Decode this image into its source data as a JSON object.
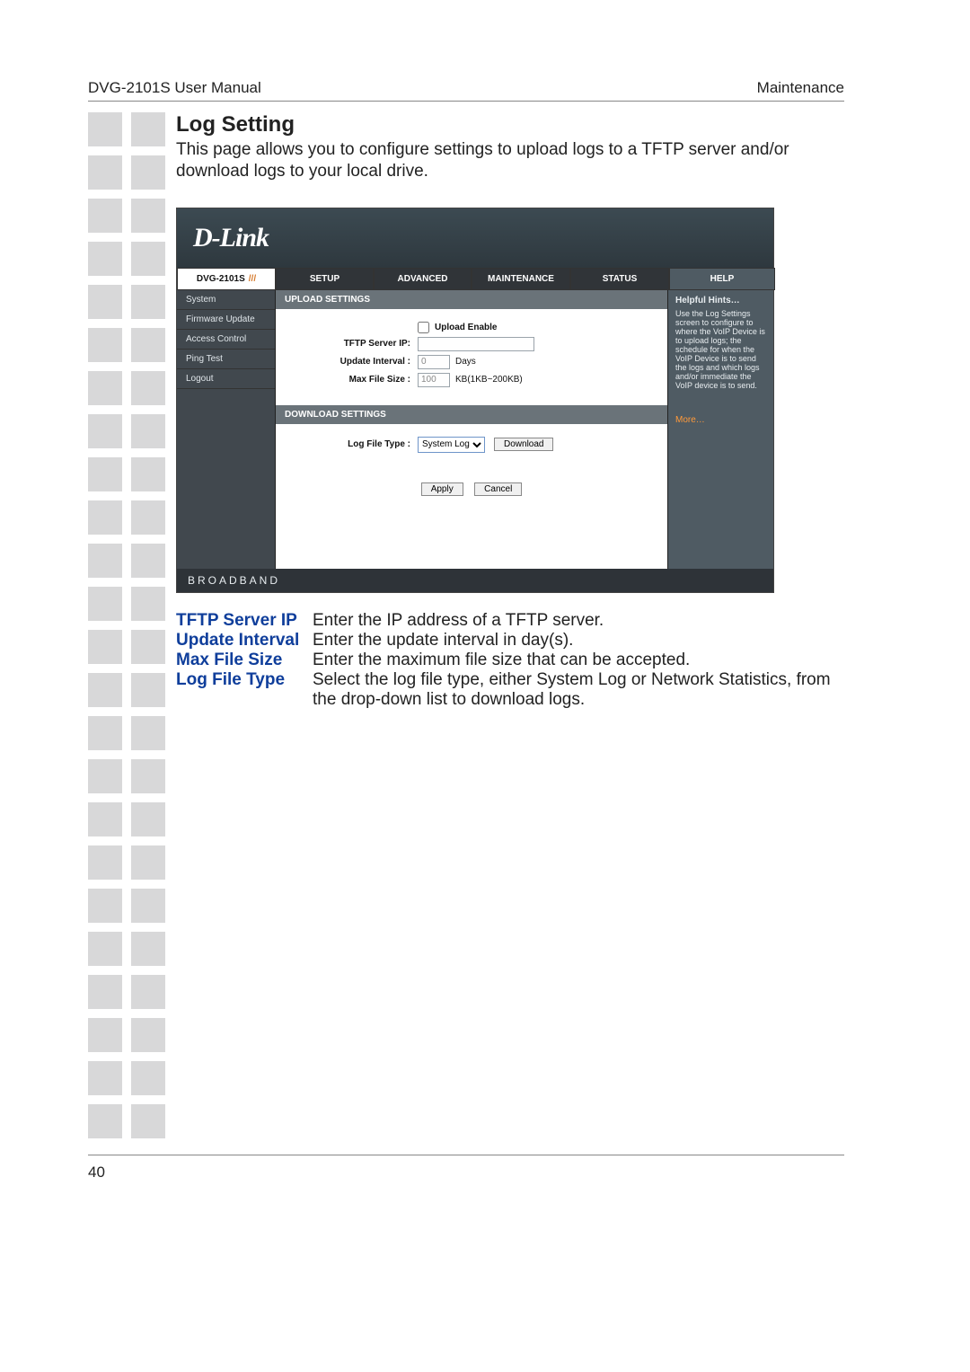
{
  "page": {
    "header_left": "DVG-2101S User Manual",
    "header_right": "Maintenance",
    "number": "40"
  },
  "section": {
    "title": "Log Setting",
    "intro": "This page allows you to configure settings to upload logs to a TFTP server and/or download logs to your local drive."
  },
  "router": {
    "logo": "D-Link",
    "model": "DVG-2101S",
    "tabs": {
      "setup": "SETUP",
      "advanced": "ADVANCED",
      "maintenance": "MAINTENANCE",
      "status": "STATUS",
      "help": "HELP"
    },
    "nav": {
      "system": "System",
      "firmware": "Firmware Update",
      "access": "Access Control",
      "ping": "Ping Test",
      "logout": "Logout"
    },
    "upload": {
      "header": "UPLOAD SETTINGS",
      "enable_label": "Upload Enable",
      "tftp_label": "TFTP Server IP:",
      "tftp_value": "",
      "interval_label": "Update Interval :",
      "interval_value": "0",
      "interval_units": "Days",
      "maxsize_label": "Max File Size :",
      "maxsize_value": "100",
      "maxsize_units": "KB(1KB~200KB)"
    },
    "download": {
      "header": "DOWNLOAD SETTINGS",
      "type_label": "Log File Type :",
      "type_value": "System Log",
      "download_btn": "Download"
    },
    "buttons": {
      "apply": "Apply",
      "cancel": "Cancel"
    },
    "help_panel": {
      "title": "Helpful Hints…",
      "body": "Use the Log Settings screen to configure to where the VoIP Device is to upload logs; the schedule for when the VoIP Device is to send the logs and which logs and/or immediate the VoIP device is to send.",
      "more": "More…"
    },
    "footer": "BROADBAND"
  },
  "fields": {
    "tftp": {
      "term": "TFTP Server IP",
      "desc": "Enter the IP address of a TFTP server."
    },
    "interval": {
      "term": "Update Interval",
      "desc": "Enter the update interval in day(s)."
    },
    "maxsize": {
      "term": "Max File Size",
      "desc": "Enter the maximum file size that can be accepted."
    },
    "logtype": {
      "term": "Log File Type",
      "desc": "Select the log file type, either System Log or Network Statistics, from the drop-down list to download logs."
    }
  }
}
